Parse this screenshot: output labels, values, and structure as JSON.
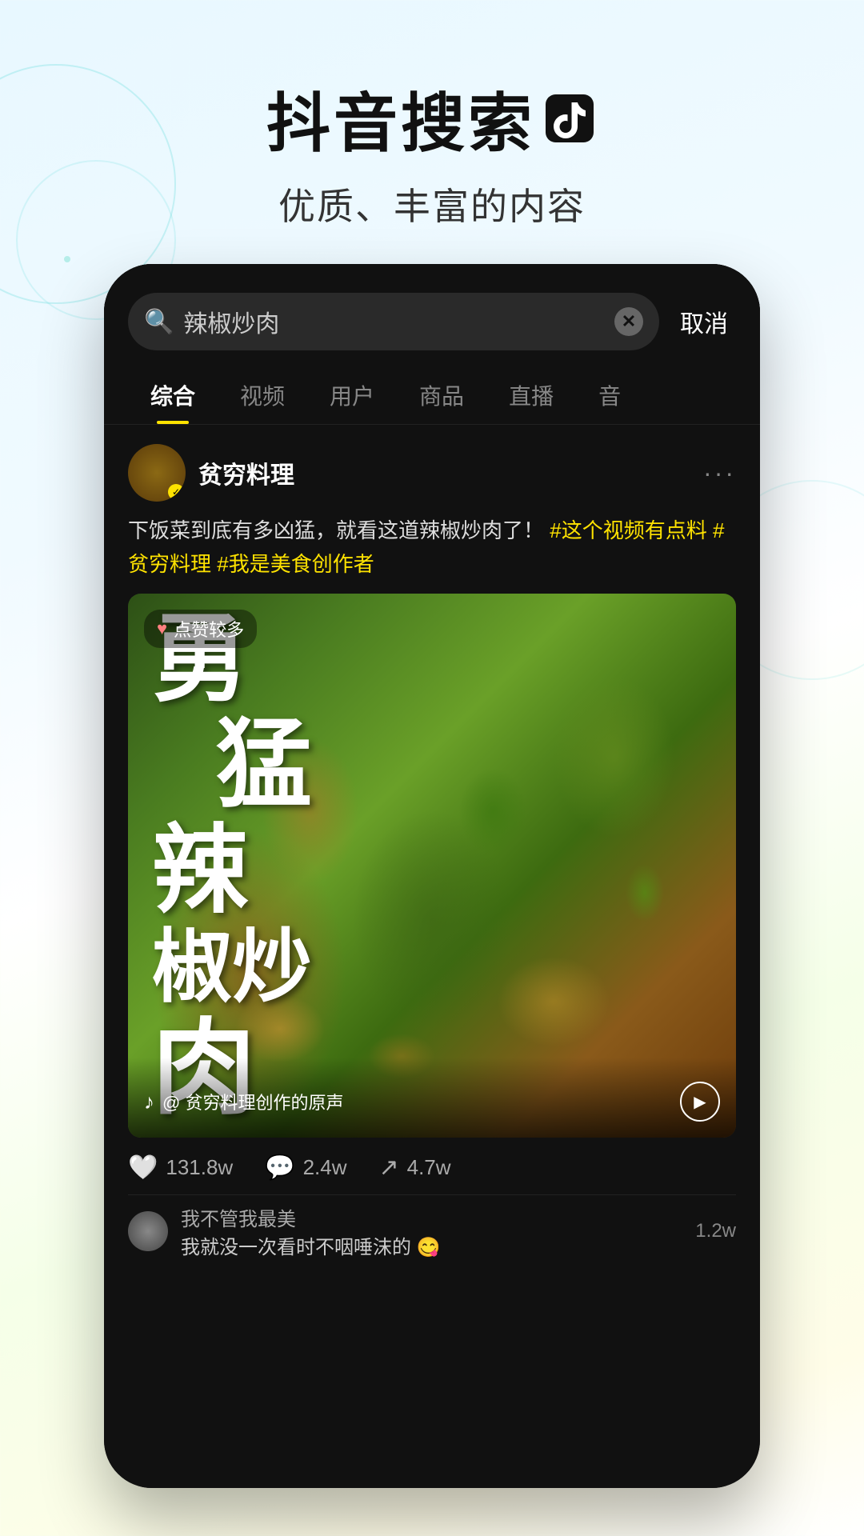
{
  "header": {
    "title": "抖音搜索",
    "subtitle": "优质、丰富的内容"
  },
  "search": {
    "query": "辣椒炒肉",
    "cancel_label": "取消",
    "placeholder": "辣椒炒肉"
  },
  "tabs": [
    {
      "label": "综合",
      "active": true
    },
    {
      "label": "视频",
      "active": false
    },
    {
      "label": "用户",
      "active": false
    },
    {
      "label": "商品",
      "active": false
    },
    {
      "label": "直播",
      "active": false
    },
    {
      "label": "音",
      "active": false
    }
  ],
  "post": {
    "username": "贫穷料理",
    "verified": true,
    "description": "下饭菜到底有多凶猛，就看这道辣椒炒肉了！",
    "hashtags": [
      "#这个视频有点料",
      "#贫穷料理",
      "#我是美食创作者"
    ],
    "likes_badge": "点赞较多",
    "video_text_lines": [
      "勇",
      "猛",
      "辣",
      "椒炒",
      "肉"
    ],
    "music_info": "@ 贫穷料理创作的原声",
    "stats": {
      "likes": "131.8w",
      "comments": "2.4w",
      "shares": "4.7w"
    }
  },
  "comments": [
    {
      "name": "我不管我最美",
      "text": "我就没一次看时不咽唾沫的",
      "likes": "1.2w"
    }
  ],
  "colors": {
    "accent": "#FEE200",
    "background_start": "#e8f8ff",
    "phone_bg": "#111111",
    "text_primary": "#ffffff",
    "text_secondary": "#888888",
    "hashtag": "#FEE200"
  }
}
